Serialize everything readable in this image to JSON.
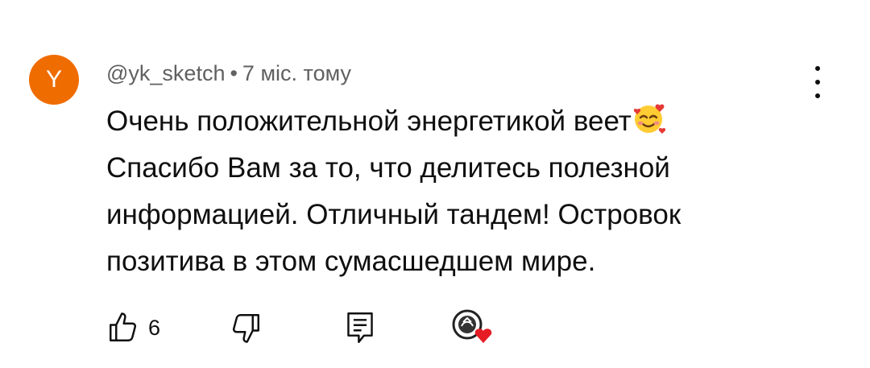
{
  "comment": {
    "avatar_letter": "Y",
    "avatar_color": "#ef6c00",
    "author": "@yk_sketch",
    "separator": "•",
    "time": "7 міс. тому",
    "text_lines": [
      "Очень положительной энергетикой веет",
      "Спасибо Вам за то, что делитесь полезной",
      "информацией. Отличный тандем! Островок",
      "позитива в этом сумасшедшем мире."
    ],
    "emoji": "smiling-face-with-hearts",
    "likes": "6"
  },
  "icons": {
    "like": "thumbs-up-icon",
    "dislike": "thumbs-down-icon",
    "reply": "reply-icon",
    "creator_heart": "creator-heart-icon",
    "more": "more-vert-icon"
  }
}
